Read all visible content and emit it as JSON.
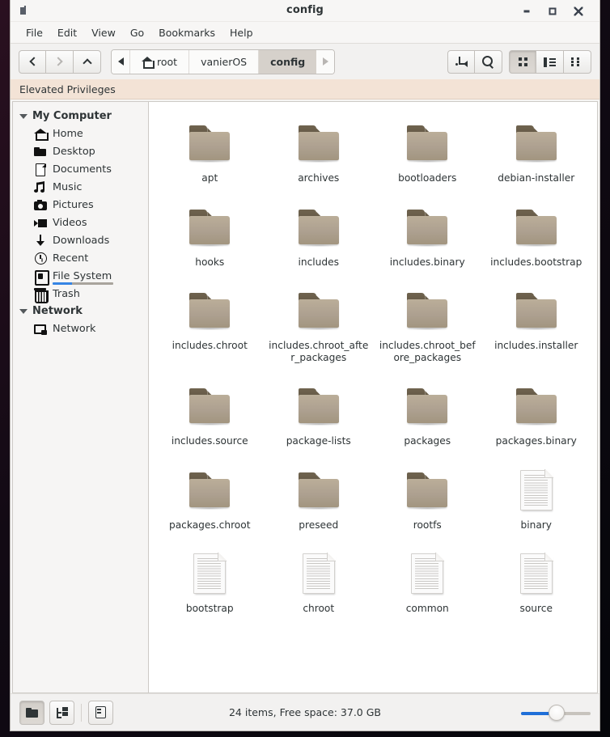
{
  "window": {
    "title": "config",
    "icon": "app-icon",
    "minimize_label": "–",
    "maximize_label": "□",
    "close_label": "×"
  },
  "menubar": {
    "items": [
      {
        "label": "File"
      },
      {
        "label": "Edit"
      },
      {
        "label": "View"
      },
      {
        "label": "Go"
      },
      {
        "label": "Bookmarks"
      },
      {
        "label": "Help"
      }
    ]
  },
  "toolbar": {
    "nav": [
      {
        "name": "back",
        "icon": "chevron-left-icon",
        "enabled": true
      },
      {
        "name": "forward",
        "icon": "chevron-right-icon",
        "enabled": false
      },
      {
        "name": "up",
        "icon": "chevron-up-icon",
        "enabled": true
      }
    ],
    "breadcrumb": {
      "scroll_left_icon": "triangle-left-icon",
      "scroll_right_icon": "triangle-right-icon",
      "crumbs": [
        {
          "label": "root",
          "icon": "home-icon",
          "active": false
        },
        {
          "label": "vanierOS",
          "icon": "",
          "active": false
        },
        {
          "label": "config",
          "icon": "",
          "active": true
        }
      ]
    },
    "actions": [
      {
        "name": "toggle-path-entry",
        "icon": "path-entry-icon"
      },
      {
        "name": "search",
        "icon": "search-icon"
      }
    ],
    "view_modes": [
      {
        "name": "icon-view",
        "icon": "grid-icon",
        "active": true
      },
      {
        "name": "list-view",
        "icon": "list-icon",
        "active": false
      },
      {
        "name": "compact-view",
        "icon": "compact-icon",
        "active": false
      }
    ]
  },
  "infobar": {
    "message": "Elevated Privileges",
    "background": "#f3e3d6"
  },
  "sidebar": {
    "groups": [
      {
        "label": "My Computer",
        "items": [
          {
            "label": "Home",
            "icon": "home-icon",
            "selected": false
          },
          {
            "label": "Desktop",
            "icon": "folder-icon",
            "selected": false
          },
          {
            "label": "Documents",
            "icon": "document-icon",
            "selected": false
          },
          {
            "label": "Music",
            "icon": "music-note-icon",
            "selected": false
          },
          {
            "label": "Pictures",
            "icon": "camera-icon",
            "selected": false
          },
          {
            "label": "Videos",
            "icon": "video-icon",
            "selected": false
          },
          {
            "label": "Downloads",
            "icon": "download-arrow-icon",
            "selected": false
          },
          {
            "label": "Recent",
            "icon": "clock-icon",
            "selected": false
          },
          {
            "label": "File System",
            "icon": "drive-icon",
            "selected": true
          },
          {
            "label": "Trash",
            "icon": "trash-icon",
            "selected": false
          }
        ]
      },
      {
        "label": "Network",
        "items": [
          {
            "label": "Network",
            "icon": "network-icon",
            "selected": false
          }
        ]
      }
    ]
  },
  "files": [
    {
      "name": "apt",
      "type": "folder"
    },
    {
      "name": "archives",
      "type": "folder"
    },
    {
      "name": "bootloaders",
      "type": "folder"
    },
    {
      "name": "debian-installer",
      "type": "folder"
    },
    {
      "name": "hooks",
      "type": "folder"
    },
    {
      "name": "includes",
      "type": "folder"
    },
    {
      "name": "includes.binary",
      "type": "folder"
    },
    {
      "name": "includes.bootstrap",
      "type": "folder"
    },
    {
      "name": "includes.chroot",
      "type": "folder"
    },
    {
      "name": "includes.chroot_after_packages",
      "type": "folder"
    },
    {
      "name": "includes.chroot_before_packages",
      "type": "folder"
    },
    {
      "name": "includes.installer",
      "type": "folder"
    },
    {
      "name": "includes.source",
      "type": "folder"
    },
    {
      "name": "package-lists",
      "type": "folder"
    },
    {
      "name": "packages",
      "type": "folder"
    },
    {
      "name": "packages.binary",
      "type": "folder"
    },
    {
      "name": "packages.chroot",
      "type": "folder"
    },
    {
      "name": "preseed",
      "type": "folder"
    },
    {
      "name": "rootfs",
      "type": "folder"
    },
    {
      "name": "binary",
      "type": "file"
    },
    {
      "name": "bootstrap",
      "type": "file"
    },
    {
      "name": "chroot",
      "type": "file"
    },
    {
      "name": "common",
      "type": "file"
    },
    {
      "name": "source",
      "type": "file"
    }
  ],
  "statusbar": {
    "buttons": [
      {
        "name": "icon-pane-button",
        "icon": "folder-icon",
        "active": true
      },
      {
        "name": "tree-pane-button",
        "icon": "tree-icon",
        "active": false
      },
      {
        "name": "side-pane-button",
        "icon": "side-pane-icon",
        "active": false
      }
    ],
    "text": "24 items, Free space: 37.0 GB",
    "zoom": {
      "value": 47,
      "min": 0,
      "max": 100
    }
  },
  "colors": {
    "accent": "#1f6fd8",
    "folder_body": "#ada090",
    "folder_tab": "#655a47",
    "infobar_bg": "#f3e3d6",
    "window_bg": "#f6f5f4"
  }
}
